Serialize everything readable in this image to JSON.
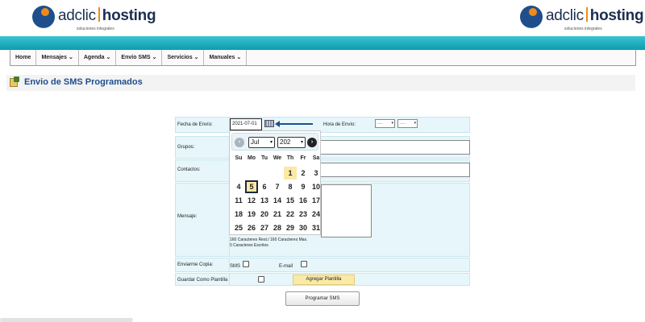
{
  "header": {
    "logo_left": {
      "name_light": "adclic",
      "name_bold": "hosting",
      "tagline": "soluciones integrales"
    },
    "logo_right": {
      "name_light": "adclic",
      "name_bold": "hosting",
      "tagline": "soluciones integrales"
    },
    "colors": {
      "teal": "#1aa9bd",
      "brand_blue": "#1e4f8c",
      "brand_orange": "#f08a1c"
    }
  },
  "nav": {
    "items": [
      {
        "label": "Home",
        "has_dropdown": false
      },
      {
        "label": "Mensajes",
        "has_dropdown": true
      },
      {
        "label": "Agenda",
        "has_dropdown": true
      },
      {
        "label": "Envío SMS",
        "has_dropdown": true
      },
      {
        "label": "Servicios",
        "has_dropdown": true
      },
      {
        "label": "Manuales",
        "has_dropdown": true
      }
    ],
    "chevron": "⌄"
  },
  "page": {
    "title": "Envio de SMS Programados",
    "icon": "sms-document-icon"
  },
  "form": {
    "fecha_label": "Fecha de Envío:",
    "fecha_value": "2021-07-01",
    "hora_label": "Hora de Envío:",
    "hora_hour": ".....",
    "hora_minute": ".....",
    "grupos_label": "Grupos:",
    "contactos_label": "Contactos:",
    "mensaje_label": "Mensaje:",
    "counter_remaining": "160 Caracteres Rest./ 160 Caracteres Max.",
    "counter_written": "0 Caracteres Escritos",
    "copia_label": "Enviarme Copia:",
    "sms_label": "SMS",
    "email_label": "E-mail",
    "plantilla_label": "Guardar Como Plantilla",
    "agregar_plantilla": "Agregar Plantilla",
    "programar": "Programar SMS"
  },
  "calendar": {
    "month": "Jul",
    "year": "202",
    "dow": [
      "Su",
      "Mo",
      "Tu",
      "We",
      "Th",
      "Fr",
      "Sa"
    ],
    "weeks": [
      [
        "",
        "",
        "",
        "",
        "1",
        "2",
        "3"
      ],
      [
        "4",
        "5",
        "6",
        "7",
        "8",
        "9",
        "10"
      ],
      [
        "11",
        "12",
        "13",
        "14",
        "15",
        "16",
        "17"
      ],
      [
        "18",
        "19",
        "20",
        "21",
        "22",
        "23",
        "24"
      ],
      [
        "25",
        "26",
        "27",
        "28",
        "29",
        "30",
        "31"
      ]
    ],
    "selected_day": "1",
    "highlighted_day": "5"
  }
}
